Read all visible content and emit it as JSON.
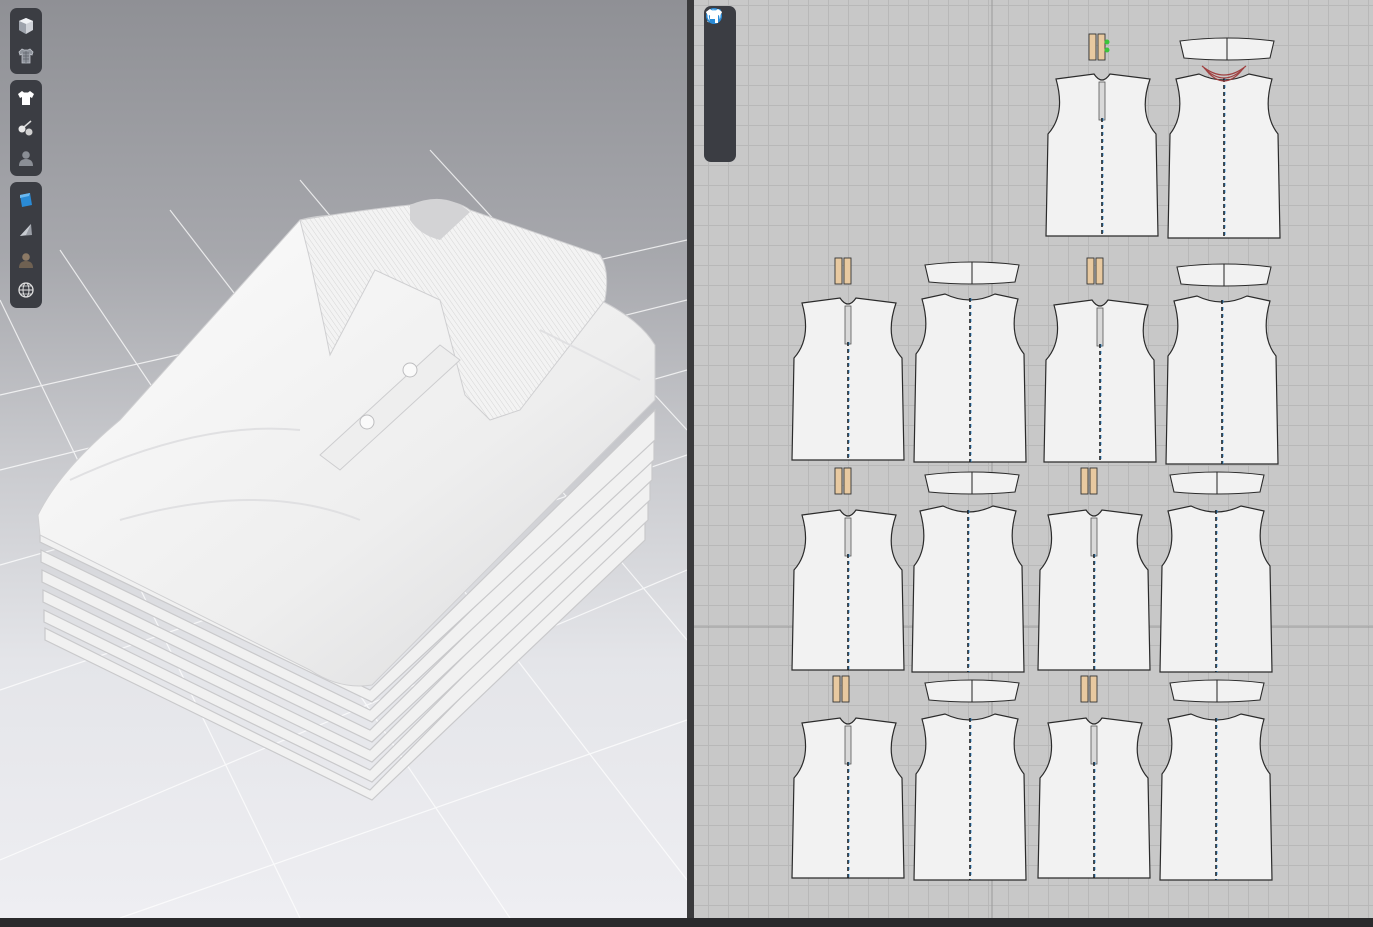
{
  "toolbar_3d": {
    "groups": [
      [
        {
          "icon": "cube-icon",
          "name": "display-avatar-button"
        },
        {
          "icon": "garment-wire-icon",
          "name": "garment-wireframe-button"
        }
      ],
      [
        {
          "icon": "tshirt-icon",
          "name": "show-garment-button"
        },
        {
          "icon": "pins-icon",
          "name": "show-pins-button"
        },
        {
          "icon": "avatar-icon",
          "name": "show-avatar-button"
        }
      ],
      [
        {
          "icon": "texture-icon",
          "name": "texture-mode-button"
        },
        {
          "icon": "mesh-shade-icon",
          "name": "shaded-mode-button"
        },
        {
          "icon": "avatar-shade-icon",
          "name": "avatar-display-button"
        },
        {
          "icon": "globe-icon",
          "name": "environment-button"
        }
      ]
    ]
  },
  "toolbar_2d": {
    "items": [
      {
        "icon": "needle-icon",
        "name": "sewing-tool-button"
      },
      {
        "icon": "tshirt-icon",
        "name": "pattern-display-button"
      },
      {
        "icon": "info-icon",
        "name": "pattern-info-button"
      },
      {
        "icon": "texture-icon",
        "name": "texture-2d-button"
      },
      {
        "icon": "tshirt-blue-icon",
        "name": "garment-2d-button"
      }
    ]
  },
  "colors": {
    "accent_blue": "#2a8bd6",
    "toolbar_bg": "#3b3d43",
    "pattern_fill": "#f2f2f2",
    "placket_fill": "#e8c9a0"
  },
  "pattern_groups_count": 7
}
